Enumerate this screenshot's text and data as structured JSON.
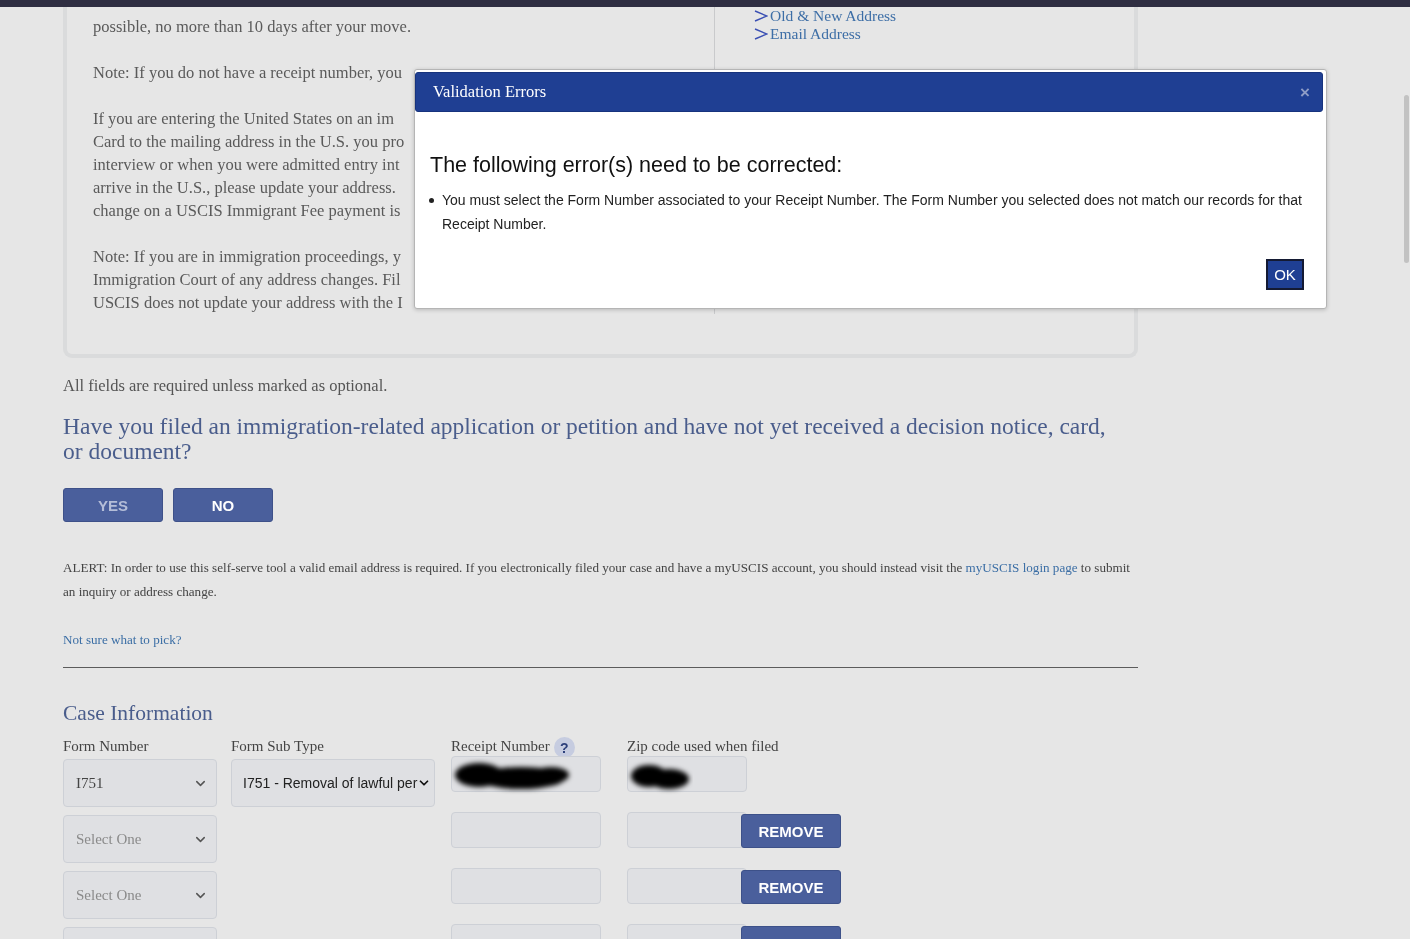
{
  "info_panel": {
    "paragraphs": [
      [
        "possible, no more than 10 days after your move."
      ],
      [
        "Note: If you do not have a receipt number, you"
      ],
      [
        "If you are entering the United States on an im",
        "Card to the mailing address in the U.S. you pro",
        "interview or when you were admitted entry int",
        "arrive in the U.S., please update your address.",
        "change on a USCIS Immigrant Fee payment is"
      ],
      [
        "Note: If you are in immigration proceedings, y",
        "Immigration Court of any address changes. Fil",
        "USCIS does not update your address with the I"
      ]
    ],
    "links": [
      "Old & New Address",
      "Email Address"
    ]
  },
  "required_note": "All fields are required unless marked as optional.",
  "question": {
    "text": "Have you filed an immigration-related application or petition and have not yet received a decision notice, card, or document?",
    "options": [
      {
        "label": "YES",
        "selected": false
      },
      {
        "label": "NO",
        "selected": true
      }
    ]
  },
  "alert": {
    "text_before": "ALERT: In order to use this self-serve tool a valid email address is required. If you electronically filed your case and have a myUSCIS account, you should instead visit the",
    "link": "myUSCIS login page",
    "text_after": "to submit an inquiry or address change."
  },
  "help_link": "Not sure what to pick?",
  "case_information": {
    "title": "Case Information",
    "columns": [
      "Form Number",
      "Form Sub Type",
      "Receipt Number",
      "Zip code used when filed"
    ],
    "receipt_help": "?",
    "rows": [
      {
        "form_number": {
          "value": "I751"
        },
        "form_sub_type": {
          "value": "I751 - Removal of lawful per"
        },
        "receipt_number": {
          "redacted": true
        },
        "zip_code": {
          "redacted": true
        }
      },
      {
        "form_number": {
          "placeholder": "Select One"
        },
        "receipt_number": {
          "redacted": false
        },
        "zip_code": {
          "redacted": false
        },
        "remove_button": {
          "label": "REMOVE"
        }
      },
      {
        "form_number": {
          "placeholder": "Select One"
        },
        "receipt_number": {
          "redacted": false
        },
        "zip_code": {
          "redacted": false
        },
        "remove_button": {
          "label": "REMOVE"
        }
      },
      {
        "form_number": {},
        "receipt_number": {
          "redacted": false
        },
        "zip_code": {
          "redacted": false
        },
        "remove_button": {}
      }
    ]
  },
  "modal": {
    "title": "Validation Errors",
    "close": "×",
    "heading": "The following error(s) need to be corrected:",
    "errors": [
      "You must select the Form Number associated to your Receipt Number. The Form Number you selected does not match our records for that Receipt Number."
    ],
    "button": "OK"
  }
}
